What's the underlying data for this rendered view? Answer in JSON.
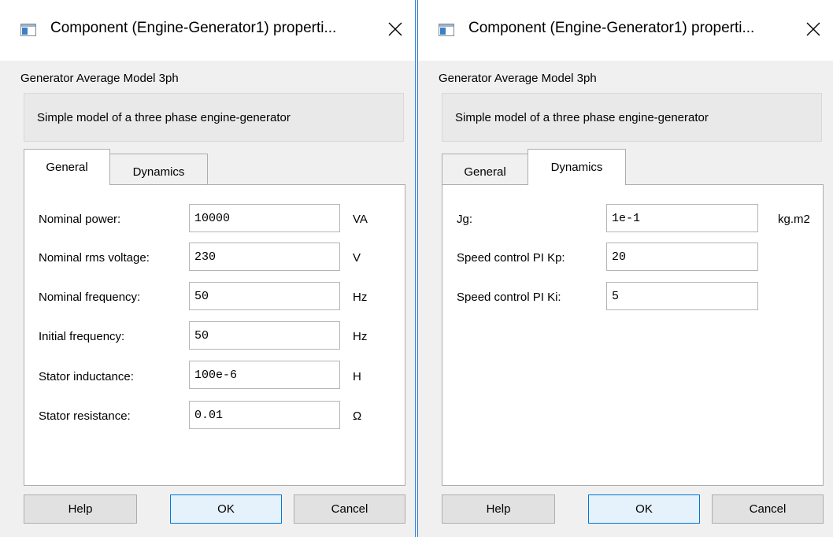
{
  "dialogs": [
    {
      "title": "Component (Engine-Generator1) properti...",
      "model_name": "Generator Average Model 3ph",
      "description": "Simple model of a three phase engine-generator",
      "tabs": [
        "General",
        "Dynamics"
      ],
      "active_tab": "General",
      "fields": [
        {
          "label": "Nominal power:",
          "value": "10000",
          "unit": "VA"
        },
        {
          "label": "Nominal rms voltage:",
          "value": "230",
          "unit": "V"
        },
        {
          "label": "Nominal frequency:",
          "value": "50",
          "unit": "Hz"
        },
        {
          "label": "Initial frequency:",
          "value": "50",
          "unit": "Hz"
        },
        {
          "label": "Stator inductance:",
          "value": "100e-6",
          "unit": "H"
        },
        {
          "label": "Stator resistance:",
          "value": "0.01",
          "unit": "Ω"
        }
      ],
      "buttons": {
        "help": "Help",
        "ok": "OK",
        "cancel": "Cancel"
      }
    },
    {
      "title": "Component (Engine-Generator1) properti...",
      "model_name": "Generator Average Model 3ph",
      "description": "Simple model of a three phase engine-generator",
      "tabs": [
        "General",
        "Dynamics"
      ],
      "active_tab": "Dynamics",
      "fields": [
        {
          "label": "Jg:",
          "value": "1e-1",
          "unit": "kg.m2"
        },
        {
          "label": "Speed control PI Kp:",
          "value": "20",
          "unit": ""
        },
        {
          "label": "Speed control PI Ki:",
          "value": "5",
          "unit": ""
        }
      ],
      "buttons": {
        "help": "Help",
        "ok": "OK",
        "cancel": "Cancel"
      }
    }
  ],
  "icons": {
    "app": "window-app-icon",
    "close": "close-icon"
  },
  "colors": {
    "accent": "#0078d7",
    "divider": "#2b7bd6"
  }
}
